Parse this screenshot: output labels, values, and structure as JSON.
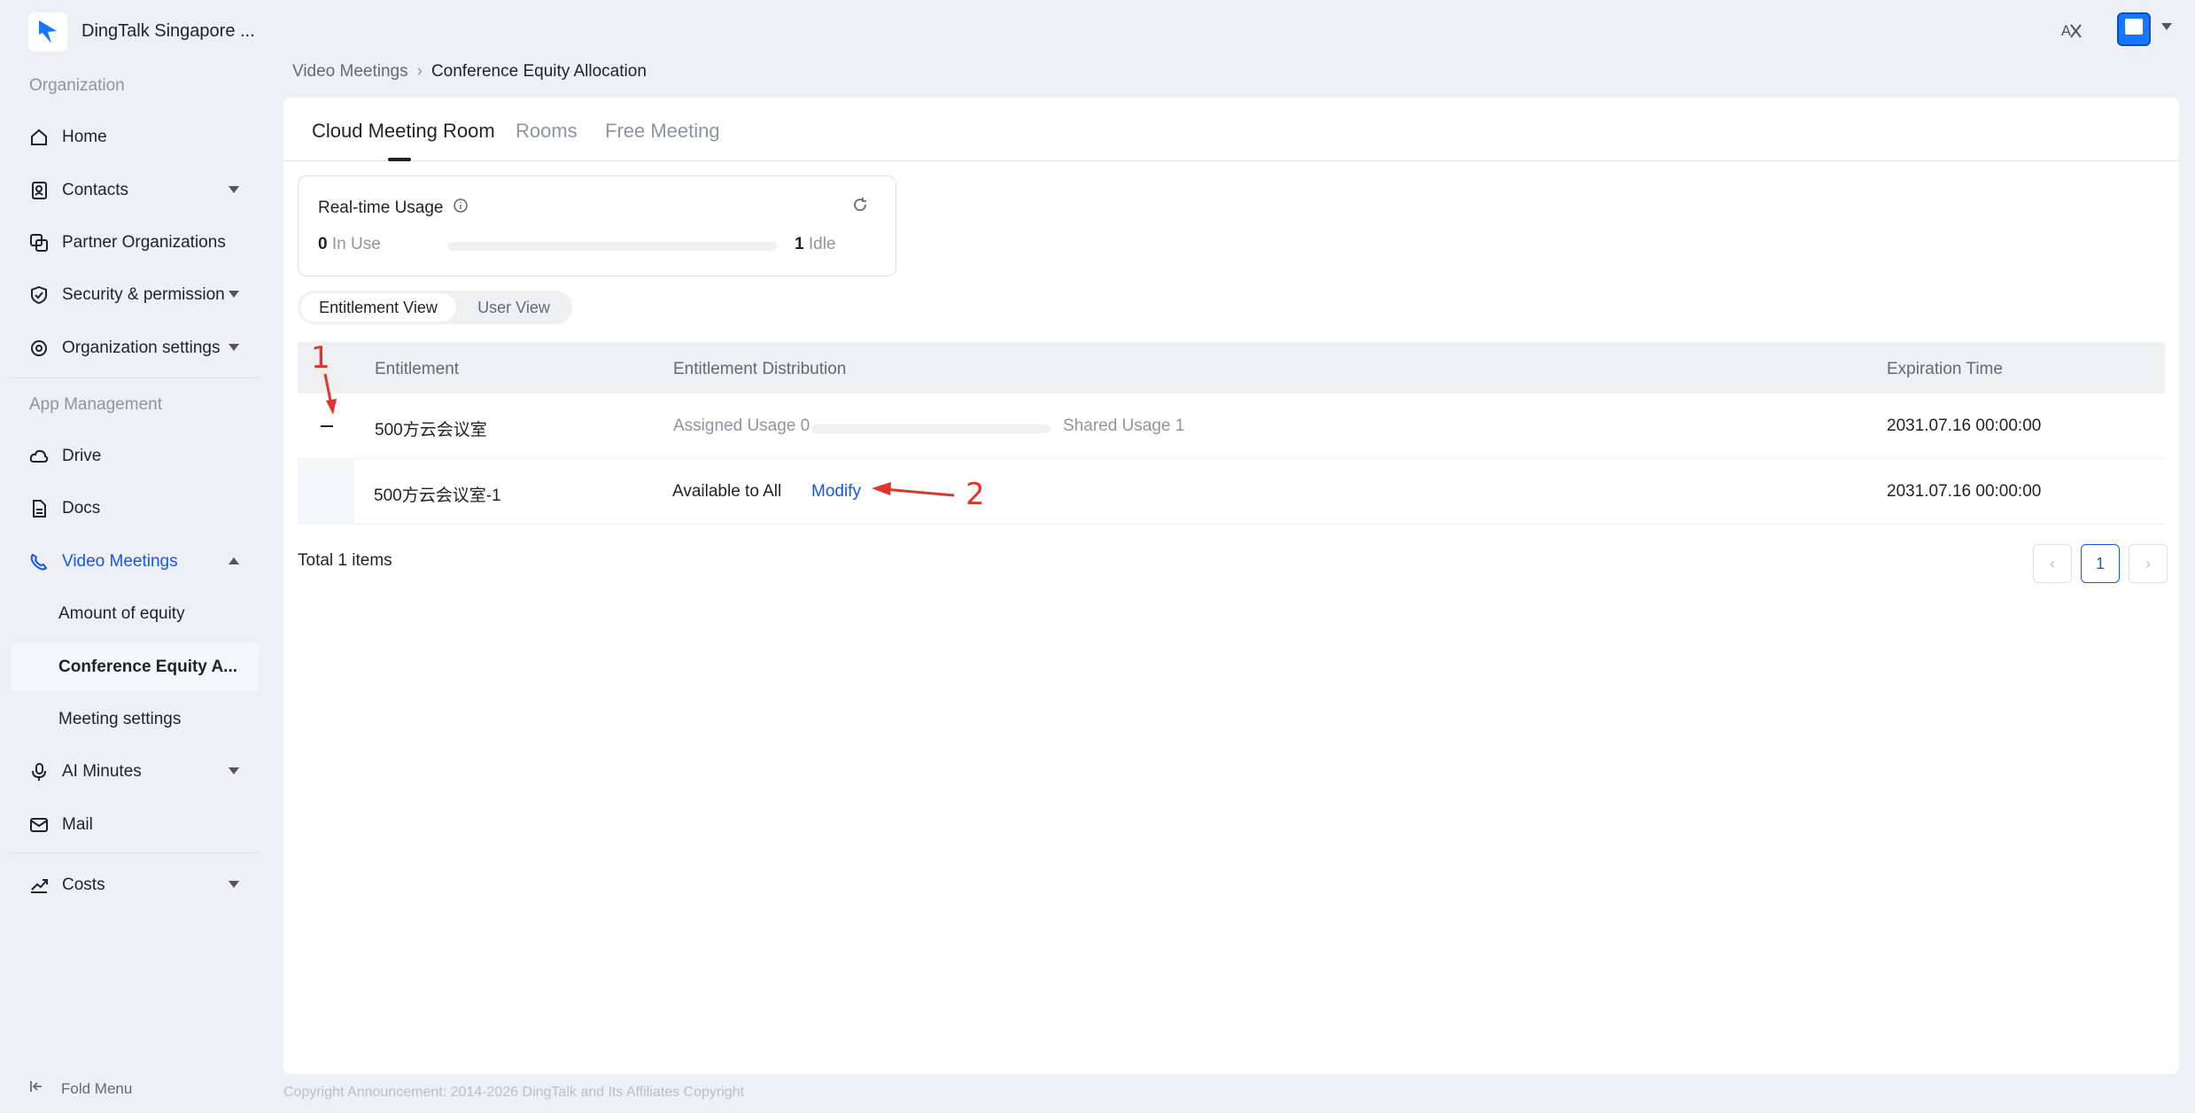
{
  "app": {
    "org_name": "DingTalk Singapore ..."
  },
  "sidebar": {
    "section_org": "Organization",
    "section_app": "App Management",
    "items": [
      {
        "label": "Home"
      },
      {
        "label": "Contacts"
      },
      {
        "label": "Partner Organizations"
      },
      {
        "label": "Security & permission"
      },
      {
        "label": "Organization settings"
      },
      {
        "label": "Drive"
      },
      {
        "label": "Docs"
      },
      {
        "label": "Video Meetings"
      },
      {
        "label": "AI Minutes"
      },
      {
        "label": "Mail"
      },
      {
        "label": "Costs"
      }
    ],
    "sub_items": [
      {
        "label": "Amount of equity"
      },
      {
        "label": "Conference Equity A..."
      },
      {
        "label": "Meeting settings"
      }
    ],
    "fold_label": "Fold Menu"
  },
  "breadcrumb": {
    "parent": "Video Meetings",
    "current": "Conference Equity Allocation"
  },
  "tabs": [
    {
      "label": "Cloud Meeting Room"
    },
    {
      "label": "Rooms"
    },
    {
      "label": "Free Meeting"
    }
  ],
  "usage": {
    "title": "Real-time Usage",
    "in_use_count": "0",
    "in_use_label": "In Use",
    "idle_count": "1",
    "idle_label": "Idle",
    "in_use_fraction": 0
  },
  "view_toggle": {
    "entitlement": "Entitlement View",
    "user": "User View"
  },
  "table": {
    "headers": {
      "entitlement": "Entitlement",
      "distribution": "Entitlement Distribution",
      "expiration": "Expiration Time"
    },
    "rows": [
      {
        "name": "500方云会议室",
        "assigned": "Assigned Usage 0",
        "shared": "Shared Usage 1",
        "assigned_fraction": 0,
        "expiration": "2031.07.16 00:00:00"
      },
      {
        "name": "500方云会议室-1",
        "availability": "Available to All",
        "action": "Modify",
        "expiration": "2031.07.16 00:00:00"
      }
    ],
    "total": "Total 1 items",
    "current_page": "1"
  },
  "annotations": {
    "one": "1",
    "two": "2"
  },
  "copyright": "Copyright Announcement: 2014-2026 DingTalk and Its Affiliates Copyright",
  "colors": {
    "accent": "#1456f0",
    "annotation": "#e0352b"
  }
}
